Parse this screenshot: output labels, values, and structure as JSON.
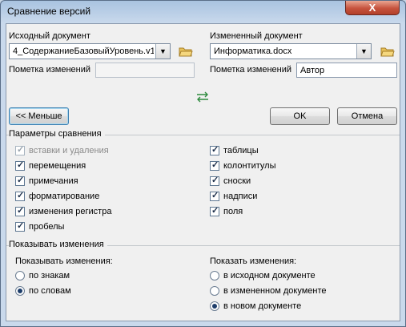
{
  "window": {
    "title": "Сравнение версий",
    "close_label": "X"
  },
  "original": {
    "label": "Исходный документ",
    "value": "4_СодержаниеБазовыйУровень.v1",
    "note_label": "Пометка изменений",
    "note_value": ""
  },
  "revised": {
    "label": "Измененный документ",
    "value": "Информатика.docx",
    "note_label": "Пометка изменений",
    "note_value": "Автор"
  },
  "buttons": {
    "less": "<< Меньше",
    "ok": "OK",
    "cancel": "Отмена"
  },
  "compare": {
    "heading": "Параметры сравнения",
    "left": [
      {
        "label": "вставки и удаления",
        "checked": true,
        "disabled": true
      },
      {
        "label": "перемещения",
        "checked": true
      },
      {
        "label": "примечания",
        "checked": true
      },
      {
        "label": "форматирование",
        "checked": true
      },
      {
        "label": "изменения регистра",
        "checked": true
      },
      {
        "label": "пробелы",
        "checked": true
      }
    ],
    "right": [
      {
        "label": "таблицы",
        "checked": true
      },
      {
        "label": "колонтитулы",
        "checked": true
      },
      {
        "label": "сноски",
        "checked": true
      },
      {
        "label": "надписи",
        "checked": true
      },
      {
        "label": "поля",
        "checked": true
      }
    ]
  },
  "show": {
    "heading": "Показывать изменения",
    "level_label": "Показывать изменения:",
    "level_options": [
      {
        "label": "по знакам",
        "selected": false
      },
      {
        "label": "по словам",
        "selected": true
      }
    ],
    "target_label": "Показать изменения:",
    "target_options": [
      {
        "label": "в исходном документе",
        "selected": false
      },
      {
        "label": "в измененном документе",
        "selected": false
      },
      {
        "label": "в новом документе",
        "selected": true
      }
    ]
  }
}
